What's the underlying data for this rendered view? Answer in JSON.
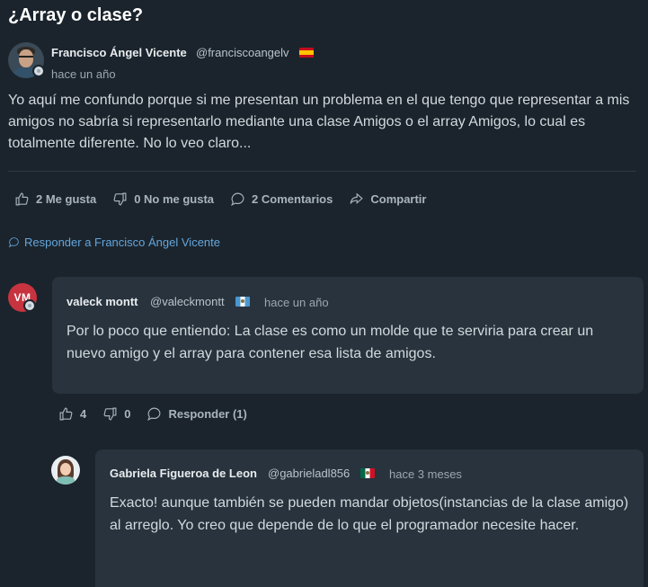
{
  "thread": {
    "title": "¿Array o clase?"
  },
  "post": {
    "author": "Francisco Ángel Vicente",
    "handle": "@franciscoangelv",
    "time": "hace un año",
    "body": "Yo aquí me confundo porque si me presentan un problema en el que tengo que representar a mis amigos no sabría si representarlo mediante una clase Amigos o el array Amigos, lo cual es totalmente diferente. No lo veo claro...",
    "actions": {
      "like": "2 Me gusta",
      "dislike": "0 No me gusta",
      "comments": "2 Comentarios",
      "share": "Compartir"
    },
    "reply_link": "Responder a Francisco Ángel Vicente"
  },
  "comments": [
    {
      "initials": "VM",
      "author": "valeck montt",
      "handle": "@valeckmontt",
      "time": "hace un año",
      "body": "Por lo poco que entiendo: La clase es como un molde que te serviria para crear un nuevo amigo y el array para contener esa lista de amigos.",
      "likes": "4",
      "dislikes": "0",
      "reply": "Responder (1)"
    },
    {
      "author": "Gabriela Figueroa de Leon",
      "handle": "@gabrieladl856",
      "time": "hace 3 meses",
      "body": "Exacto! aunque también se pueden mandar objetos(instancias de la clase amigo) al arreglo. Yo creo que depende de lo que el programador necesite hacer."
    }
  ],
  "icons": {
    "like": "thumbs-up-icon",
    "dislike": "thumbs-down-icon",
    "comment": "comment-bubble-icon",
    "share": "share-arrow-icon"
  },
  "colors": {
    "background": "#1b242c",
    "card": "#28333d",
    "link": "#63a6dd",
    "avatar_vm": "#c7343f"
  }
}
